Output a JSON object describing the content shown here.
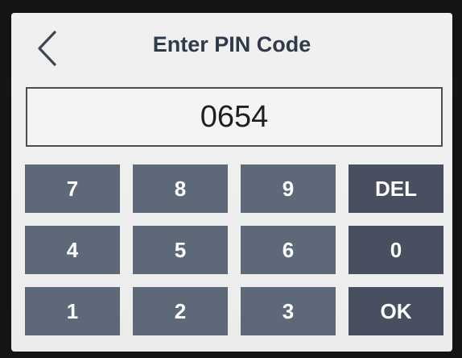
{
  "header": {
    "title": "Enter PIN Code",
    "back_icon": "chevron-left-icon"
  },
  "pin": {
    "value": "0654"
  },
  "keypad": {
    "keys": [
      {
        "label": "7"
      },
      {
        "label": "8"
      },
      {
        "label": "9"
      },
      {
        "label": "DEL"
      },
      {
        "label": "4"
      },
      {
        "label": "5"
      },
      {
        "label": "6"
      },
      {
        "label": "0"
      },
      {
        "label": "1"
      },
      {
        "label": "2"
      },
      {
        "label": "3"
      },
      {
        "label": "OK"
      }
    ]
  },
  "colors": {
    "number_key": "#5d6879",
    "function_key": "#474f60",
    "title": "#2f3b4c"
  }
}
